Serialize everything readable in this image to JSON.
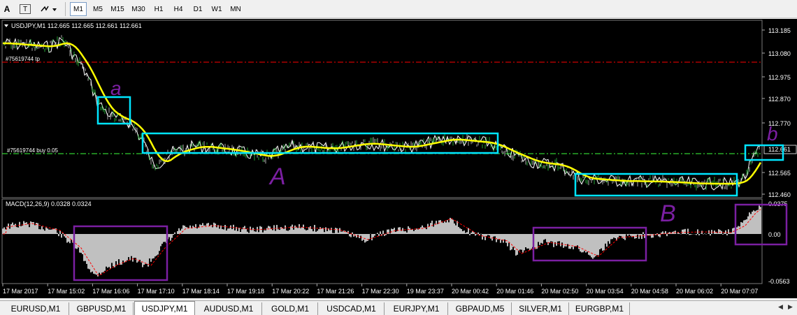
{
  "toolbar": {
    "text_tool_label": "A",
    "text_label_tool_label": "T",
    "timeframes": [
      "M1",
      "M5",
      "M15",
      "M30",
      "H1",
      "H4",
      "D1",
      "W1",
      "MN"
    ],
    "active_timeframe": "M1"
  },
  "chart": {
    "title": "USDJPY,M1  112.665 112.665 112.661 112.661",
    "order_tp_label": "#75619744 tp",
    "order_buy_label": "#75619744 buy 0.05",
    "price_axis": [
      "113.185",
      "113.080",
      "112.975",
      "112.870",
      "112.770",
      "112.661",
      "112.565",
      "112.460"
    ],
    "current_price_label": "112.661",
    "macd_title": "MACD(12,26,9) 0.0328 0.0324",
    "macd_axis": [
      "0.0375",
      "0.00",
      "-0.0563"
    ],
    "time_axis": [
      "17 Mar 2017",
      "17 Mar 15:02",
      "17 Mar 16:06",
      "17 Mar 17:10",
      "17 Mar 18:14",
      "17 Mar 19:18",
      "17 Mar 20:22",
      "17 Mar 21:26",
      "17 Mar 22:30",
      "19 Mar 23:37",
      "20 Mar 00:42",
      "20 Mar 01:46",
      "20 Mar 02:50",
      "20 Mar 03:54",
      "20 Mar 04:58",
      "20 Mar 06:02",
      "20 Mar 07:07"
    ],
    "annotations": {
      "a_lower": "a",
      "a_upper": "A",
      "b_lower": "b",
      "b_upper": "B"
    },
    "colors": {
      "background": "#000000",
      "price_line": "#ffffff",
      "ma_line": "#ffff00",
      "tp_line": "#ff0000",
      "buy_line": "#00ff00",
      "cyan_box": "#00e5ff",
      "purple": "#7b1fa2",
      "macd_hist": "#c0c0c0",
      "macd_signal": "#ff0000",
      "axis_text": "#ffffff"
    }
  },
  "tabs": [
    {
      "label": "EURUSD,M1",
      "active": false
    },
    {
      "label": "GBPUSD,M1",
      "active": false
    },
    {
      "label": "USDJPY,M1",
      "active": true
    },
    {
      "label": "AUDUSD,M1",
      "active": false
    },
    {
      "label": "GOLD,M1",
      "active": false
    },
    {
      "label": "USDCAD,M1",
      "active": false
    },
    {
      "label": "EURJPY,M1",
      "active": false
    },
    {
      "label": "GBPAUD,M5",
      "active": false
    },
    {
      "label": "SILVER,M1",
      "active": false
    },
    {
      "label": "EURGBP,M1",
      "active": false
    }
  ],
  "tab_nav": {
    "left": "◀",
    "right": "▶"
  }
}
